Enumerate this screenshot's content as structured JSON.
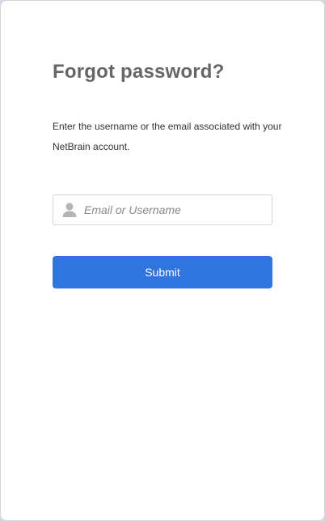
{
  "form": {
    "title": "Forgot password?",
    "description": "Enter the username or the email associated with your NetBrain account.",
    "input": {
      "placeholder": "Email or Username",
      "value": "",
      "icon": "user-icon"
    },
    "submit_label": "Submit"
  },
  "colors": {
    "primary": "#2f74df",
    "title": "#666666",
    "background": "#d3d7de"
  }
}
